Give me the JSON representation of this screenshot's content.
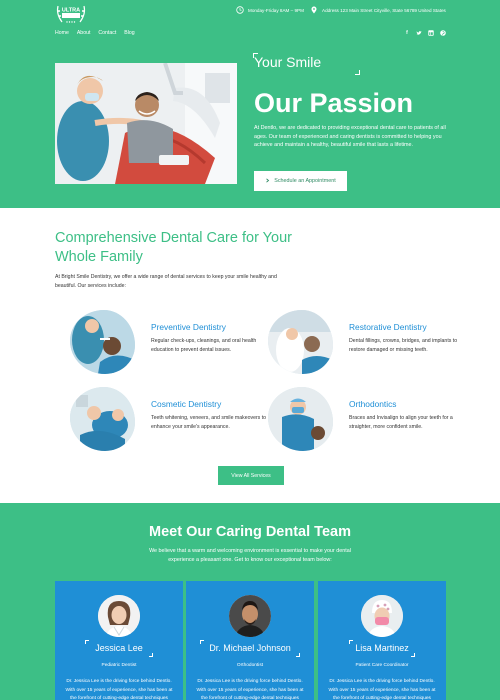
{
  "header": {
    "logo_text": "ULTRA",
    "hours": "Monday-Friday 8AM – 9PM",
    "address": "Address 123 Main Street Cityville, State 56789 United States",
    "nav": [
      "Home",
      "About",
      "Contact",
      "Blog"
    ],
    "social_icons": [
      "facebook-icon",
      "twitter-icon",
      "linkedin-icon",
      "pinterest-icon"
    ]
  },
  "hero": {
    "tagline": "Your Smile",
    "title": "Our Passion",
    "text": "At Dentlo, we are dedicated to providing exceptional dental care to patients of all ages. Our team of experienced and caring dentists is committed to helping you achieve and maintain a healthy, beautiful smile that lasts a lifetime.",
    "cta_label": "Schedule an Appointment"
  },
  "services": {
    "title": "Comprehensive Dental Care for Your Whole Family",
    "intro": "At Bright Smile Dentistry, we offer a wide range of dental services to keep your smile healthy and beautiful. Our services include:",
    "items": [
      {
        "name": "Preventive Dentistry",
        "desc": "Regular check-ups, cleanings, and oral health education to prevent dental issues."
      },
      {
        "name": "Restorative Dentistry",
        "desc": "Dental fillings, crowns, bridges, and implants to restore damaged or missing teeth."
      },
      {
        "name": "Cosmetic Dentistry",
        "desc": "Teeth whitening, veneers, and smile makeovers to enhance your smile's appearance."
      },
      {
        "name": "Orthodontics",
        "desc": "Braces and Invisalign to align your teeth for a straighter, more confident smile."
      }
    ],
    "view_all_label": "View All Services"
  },
  "team": {
    "title": "Meet Our Caring Dental Team",
    "intro": "We believe that a warm and welcoming environment is essential to make your dental experience a pleasant one. Get to know our exceptional team below:",
    "members": [
      {
        "name": "Jessica Lee",
        "role": "Pediatric Dentist",
        "bio": "Dr. Jessica Lee is the driving force behind Dentlo. With over 15 years of experience, she has been at the forefront of cutting-edge dental techniques"
      },
      {
        "name": "Dr. Michael Johnson",
        "role": "Orthodontist",
        "bio": "Dr. Jessica Lee is the driving force behind Dentlo. With over 15 years of experience, she has been at the forefront of cutting-edge dental techniques"
      },
      {
        "name": "Lisa Martinez",
        "role": "Patient Care Coordinator",
        "bio": "Dr. Jessica Lee is the driving force behind Dentlo. With over 15 years of experience, she has been at the forefront of cutting-edge dental techniques"
      }
    ]
  },
  "colors": {
    "brand_green": "#3dbf86",
    "accent_blue": "#1f8fd6"
  }
}
